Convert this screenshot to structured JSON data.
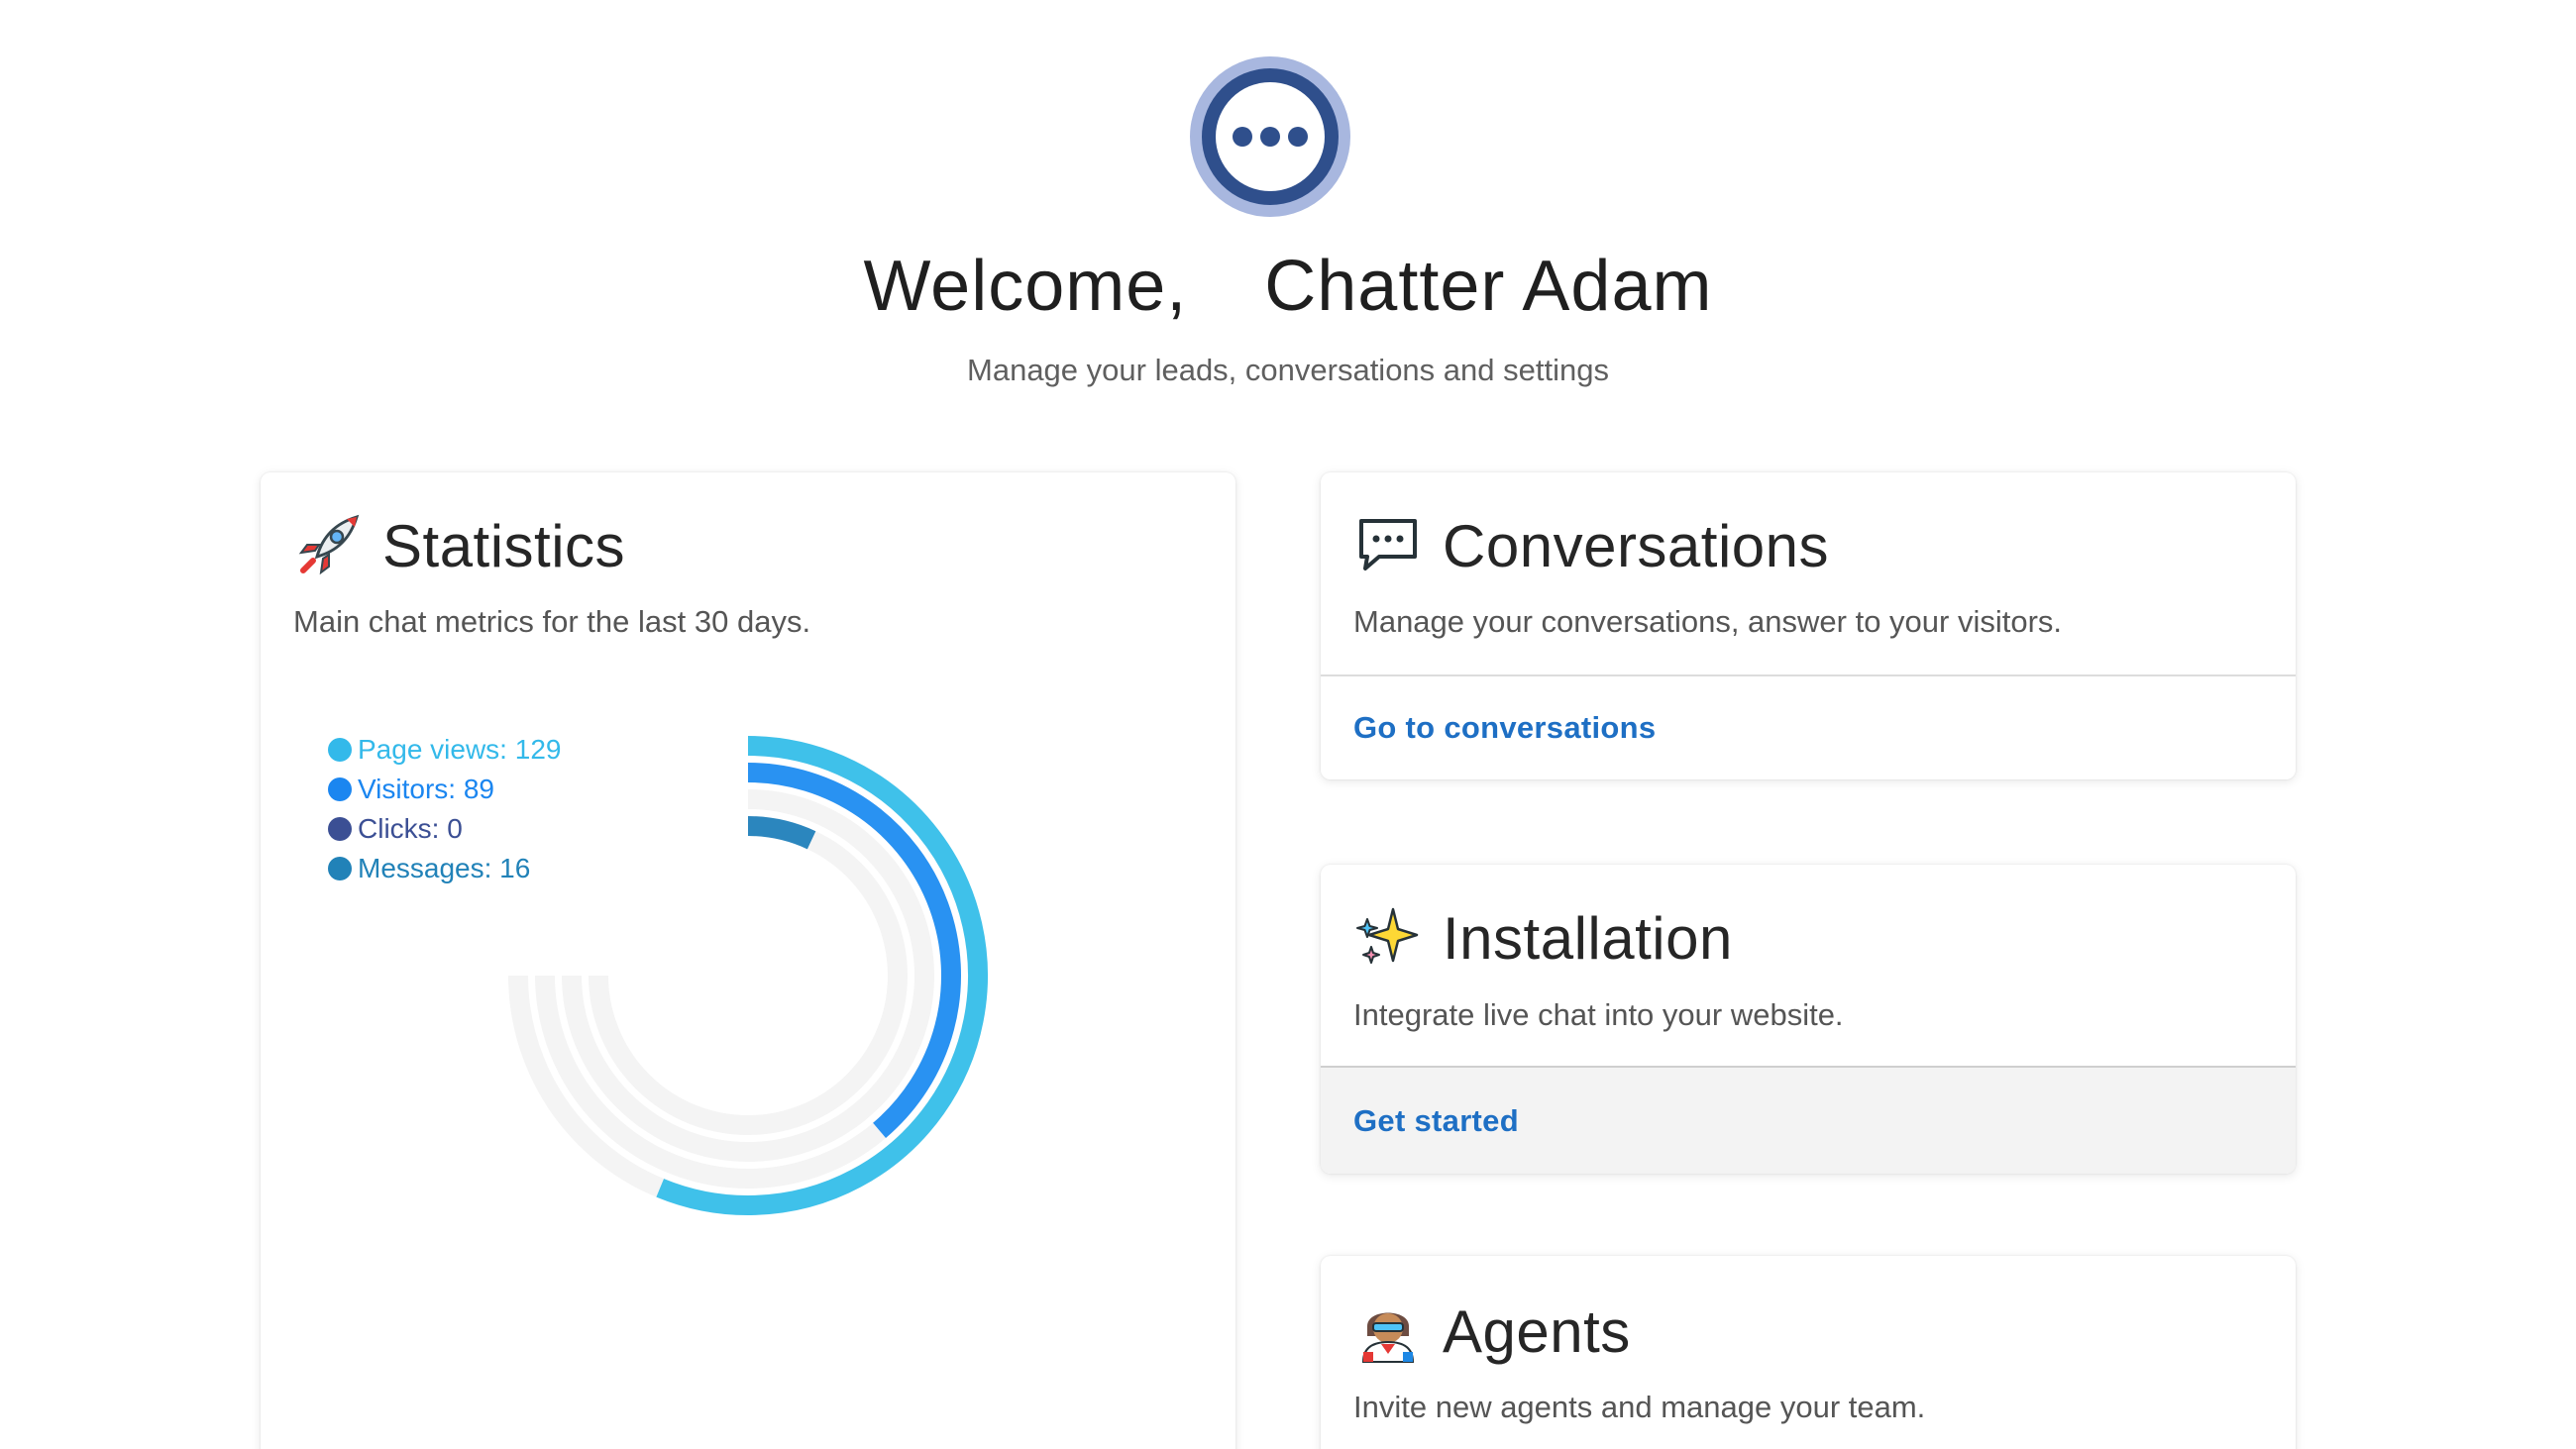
{
  "header": {
    "greeting": "Welcome,",
    "user_name": "Chatter Adam",
    "subtitle": "Manage your leads, conversations and settings"
  },
  "statistics": {
    "title": "Statistics",
    "icon": "rocket-icon",
    "description": "Main chat metrics for the last 30 days.",
    "legend": [
      {
        "label": "Page views: 129",
        "color": "#33b9ea"
      },
      {
        "label": "Visitors: 89",
        "color": "#1b86f0"
      },
      {
        "label": "Clicks: 0",
        "color": "#3b4f94"
      },
      {
        "label": "Messages: 16",
        "color": "#2182b8"
      }
    ]
  },
  "chart_data": {
    "type": "radial-bar",
    "categories": [
      "Page views",
      "Visitors",
      "Clicks",
      "Messages"
    ],
    "values": [
      129,
      89,
      0,
      16
    ],
    "colors": [
      "#3fc1ea",
      "#2992f2",
      "#3b4f94",
      "#2b86be"
    ],
    "max": 172,
    "track_color": "#f4f4f4",
    "legend_position": "top-left"
  },
  "conversations": {
    "title": "Conversations",
    "icon": "chat-bubble-icon",
    "description": "Manage your conversations, answer to your visitors.",
    "action": "Go to conversations"
  },
  "installation": {
    "title": "Installation",
    "icon": "sparkles-icon",
    "description": "Integrate live chat into your website.",
    "action": "Get started"
  },
  "agents": {
    "title": "Agents",
    "icon": "agent-avatar-icon",
    "description": "Invite new agents and manage your team."
  }
}
